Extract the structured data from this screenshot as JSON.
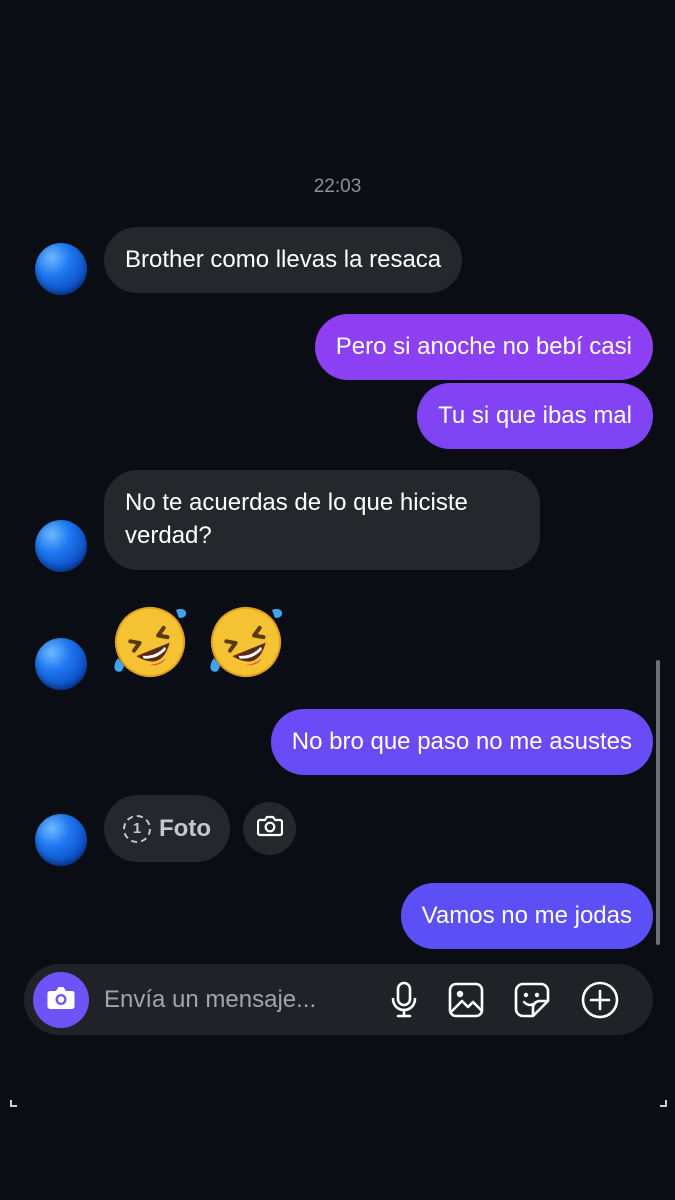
{
  "chat": {
    "timestamp": "22:03",
    "messages": [
      {
        "from": "them",
        "text": "Brother como llevas la resaca"
      },
      {
        "from": "me",
        "text": "Pero si anoche no bebí casi"
      },
      {
        "from": "me",
        "text": "Tu si que ibas mal"
      },
      {
        "from": "them",
        "text_line1": "No te acuerdas de lo que hiciste",
        "text_line2": "verdad?"
      },
      {
        "from": "them",
        "emojis": [
          "rolling-on-floor-laughing",
          "rolling-on-floor-laughing"
        ]
      },
      {
        "from": "me",
        "text": "No bro que paso no me asustes"
      },
      {
        "from": "them",
        "attachment_count": "1",
        "attachment_label": "Foto"
      },
      {
        "from": "me",
        "text": "Vamos no me jodas"
      }
    ]
  },
  "composer": {
    "placeholder": "Envía un mensaje...",
    "icons": [
      "camera-icon",
      "microphone-icon",
      "gallery-icon",
      "sticker-icon",
      "plus-icon"
    ]
  },
  "colors": {
    "background": "#0b0d14",
    "incoming_bubble": "#25272d",
    "outgoing_gradient_top": "#8d3ff2",
    "outgoing_gradient_bottom": "#5a4ff5",
    "camera_button": "#6e54f6"
  }
}
